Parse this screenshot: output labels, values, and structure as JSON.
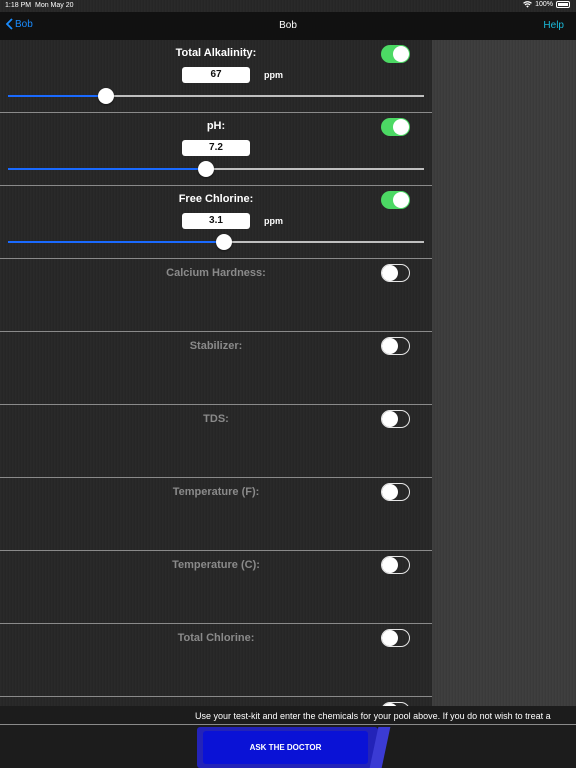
{
  "status_bar": {
    "time": "1:18 PM",
    "date": "Mon May 20",
    "battery": "100%"
  },
  "nav": {
    "back_label": "Bob",
    "title": "Bob",
    "help_label": "Help"
  },
  "rows": [
    {
      "label": "Total Alkalinity:",
      "enabled": true,
      "value": "67",
      "unit": "ppm",
      "slider_fraction": 0.235
    },
    {
      "label": "pH:",
      "enabled": true,
      "value": "7.2",
      "unit": "",
      "slider_fraction": 0.475
    },
    {
      "label": "Free Chlorine:",
      "enabled": true,
      "value": "3.1",
      "unit": "ppm",
      "slider_fraction": 0.52
    },
    {
      "label": "Calcium Hardness:",
      "enabled": false
    },
    {
      "label": "Stabilizer:",
      "enabled": false
    },
    {
      "label": "TDS:",
      "enabled": false
    },
    {
      "label": "Temperature (F):",
      "enabled": false
    },
    {
      "label": "Temperature (C):",
      "enabled": false
    },
    {
      "label": "Total Chlorine:",
      "enabled": false
    }
  ],
  "ticker_text": "Use your test-kit and enter the chemicals for your pool above. If you do not wish to treat a",
  "action_button": {
    "label": "ASK THE DOCTOR"
  },
  "colors": {
    "toggle_on": "#4cd964",
    "slider_fill": "#1a6aff",
    "nav_link": "#1a8cff",
    "help_link": "#1abcdc",
    "button_bg": "#0a12d6"
  }
}
